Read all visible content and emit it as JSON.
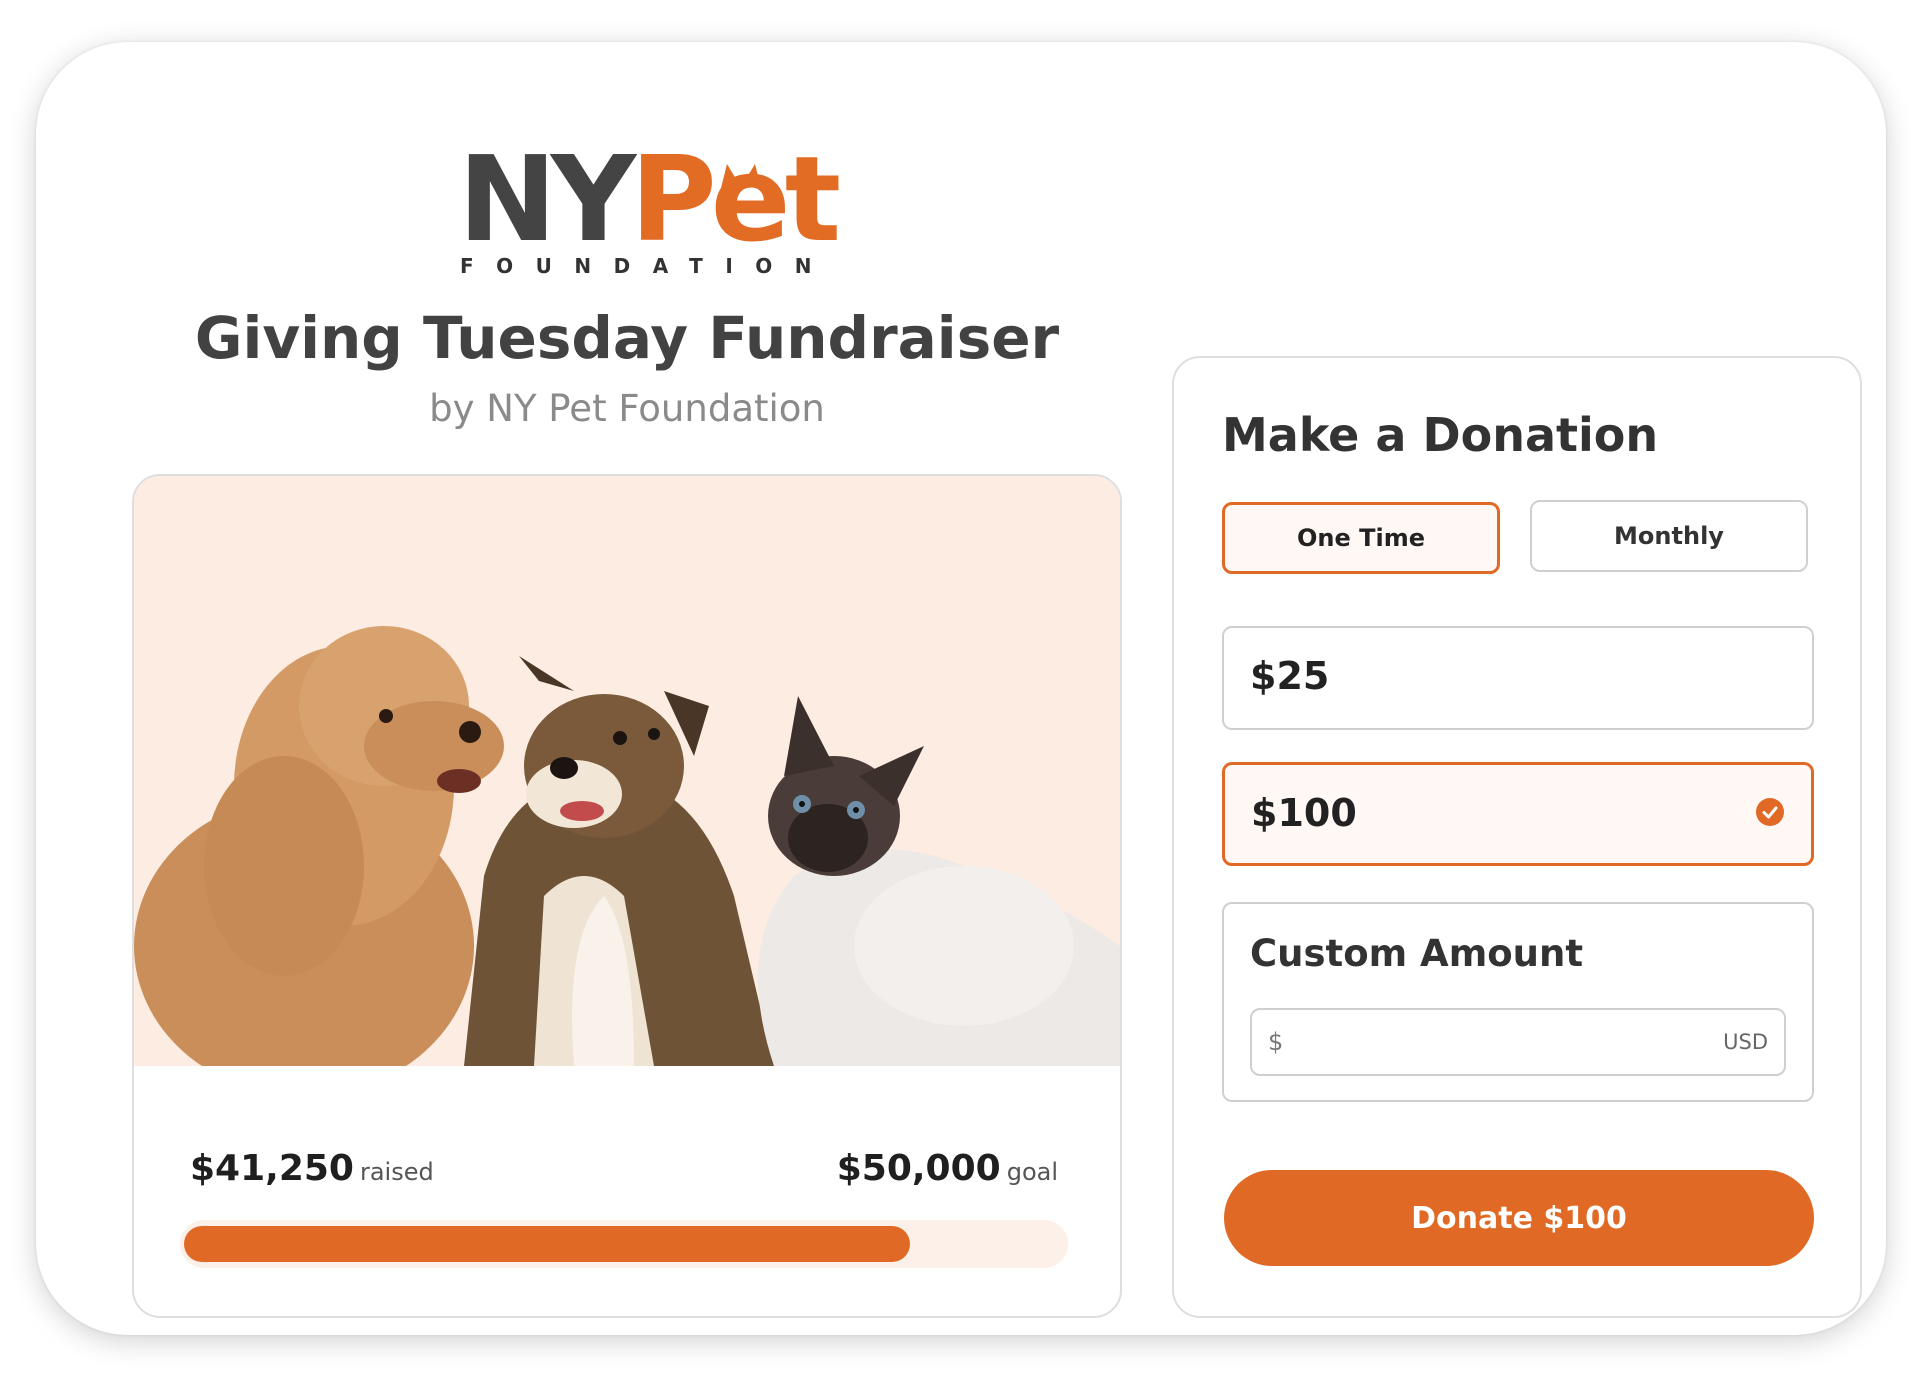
{
  "colors": {
    "accent": "#e06a25",
    "logo_dark": "#444444",
    "hero_background": "#fdece2"
  },
  "logo": {
    "word_primary": "NY",
    "word_accent": "Pet",
    "subtitle": "FOUNDATION"
  },
  "page": {
    "title": "Giving Tuesday Fundraiser",
    "subtitle": "by NY Pet Foundation"
  },
  "campaign": {
    "raised_amount": "$41,250",
    "raised_label": "raised",
    "goal_amount": "$50,000",
    "goal_label": "goal",
    "progress_fraction": 0.825
  },
  "donation": {
    "title": "Make a Donation",
    "frequency_options": [
      "One Time",
      "Monthly"
    ],
    "selected_frequency": "One Time",
    "amount_options": [
      "$25",
      "$100"
    ],
    "selected_amount": "$100",
    "custom_amount_label": "Custom Amount",
    "custom_amount_value": "",
    "currency_symbol": "$",
    "currency_code": "USD",
    "submit_label": "Donate $100"
  }
}
